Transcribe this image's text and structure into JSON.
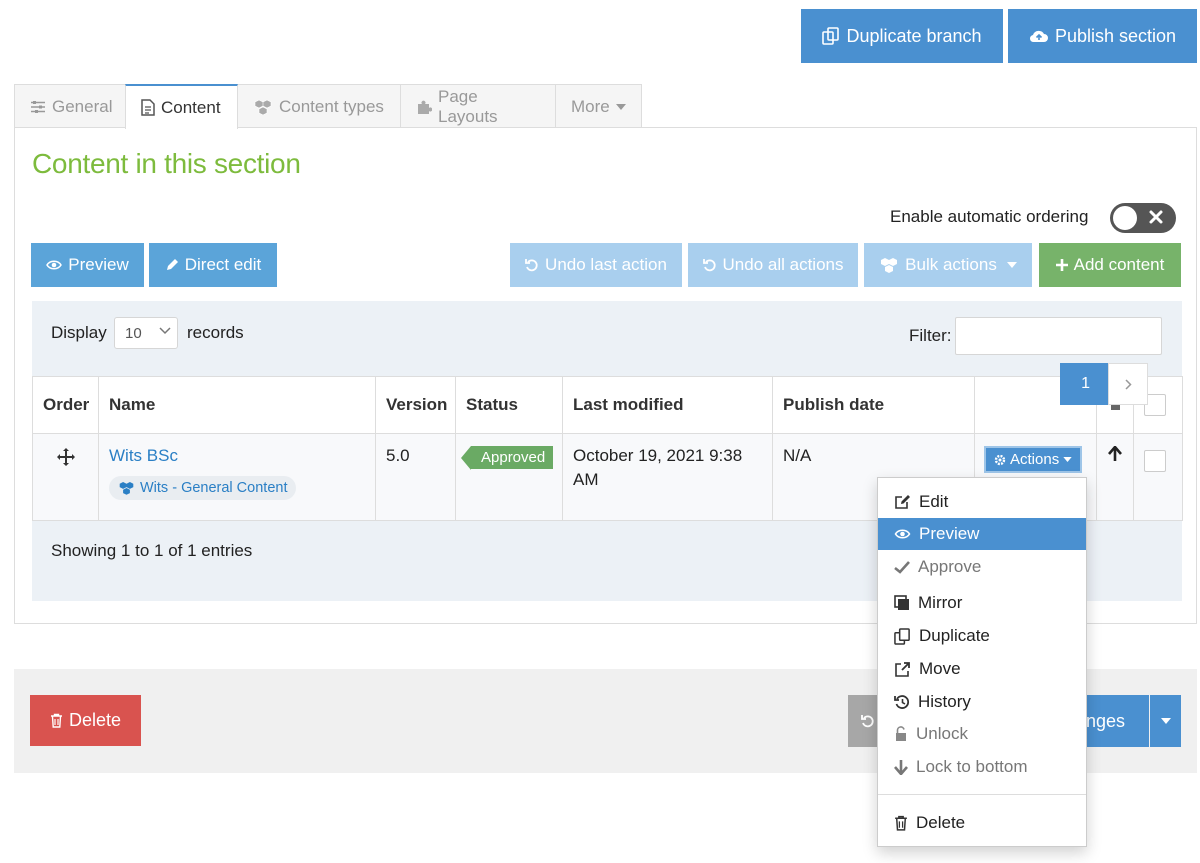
{
  "header": {
    "duplicate_branch": "Duplicate branch",
    "publish_section": "Publish section"
  },
  "tabs": [
    {
      "label": "General",
      "icon": "sliders-icon"
    },
    {
      "label": "Content",
      "icon": "document-icon",
      "active": true
    },
    {
      "label": "Content types",
      "icon": "cubes-icon"
    },
    {
      "label": "Page Layouts",
      "icon": "puzzle-icon"
    },
    {
      "label": "More",
      "icon": "caret-down-icon"
    }
  ],
  "section": {
    "title": "Content in this section",
    "auto_ordering_label": "Enable automatic ordering"
  },
  "toolbar": {
    "preview": "Preview",
    "direct_edit": "Direct edit",
    "undo_last": "Undo last action",
    "undo_all": "Undo all actions",
    "bulk_actions": "Bulk actions",
    "add_content": "Add content"
  },
  "list": {
    "display_label": "Display",
    "display_value": "10",
    "records_label": "records",
    "filter_label": "Filter:",
    "filter_value": "",
    "columns": [
      "Order",
      "Name",
      "Version",
      "Status",
      "Last modified",
      "Publish date"
    ],
    "rows": [
      {
        "name": "Wits BSc",
        "type": "Wits - General Content",
        "version": "5.0",
        "status": "Approved",
        "last_modified": "October 19, 2021 9:38 AM",
        "publish_date": "N/A",
        "actions_label": "Actions"
      }
    ],
    "showing": "Showing 1 to 1 of 1 entries",
    "page_current": "1"
  },
  "footer": {
    "delete": "Delete",
    "save_partial": "nges"
  },
  "menu": {
    "items": [
      {
        "label": "Edit",
        "icon": "edit-icon"
      },
      {
        "label": "Preview",
        "icon": "eye-icon"
      },
      {
        "label": "Approve",
        "icon": "check-icon"
      },
      {
        "label": "Mirror",
        "icon": "mirror-icon"
      },
      {
        "label": "Duplicate",
        "icon": "copy-icon"
      },
      {
        "label": "Move",
        "icon": "external-link-icon"
      },
      {
        "label": "History",
        "icon": "history-icon"
      },
      {
        "label": "Unlock",
        "icon": "unlock-icon"
      },
      {
        "label": "Lock to bottom",
        "icon": "arrow-down-icon"
      },
      {
        "label": "Delete",
        "icon": "trash-icon"
      }
    ]
  },
  "colors": {
    "primary": "#4a90d0",
    "primary_light": "#9ec5e8",
    "success": "#6aaa64",
    "danger": "#d9534f",
    "title_green": "#7dbb3d"
  }
}
